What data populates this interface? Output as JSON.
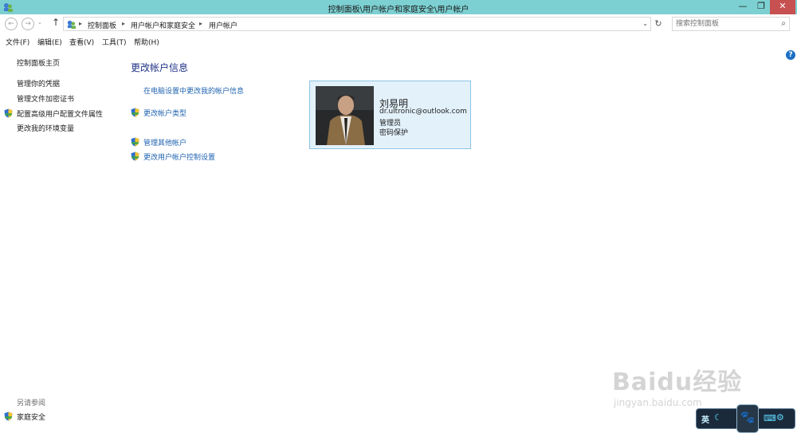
{
  "window": {
    "title": "控制面板\\用户帐户和家庭安全\\用户帐户",
    "minimize_glyph": "—",
    "maximize_glyph": "❐",
    "close_glyph": "✕"
  },
  "address": {
    "crumbs": [
      "控制面板",
      "用户帐户和家庭安全",
      "用户帐户"
    ],
    "separator": "▸",
    "search_placeholder": "搜索控制面板"
  },
  "menu": [
    "文件(F)",
    "编辑(E)",
    "查看(V)",
    "工具(T)",
    "帮助(H)"
  ],
  "sidebar": {
    "home": "控制面板主页",
    "links": [
      "管理你的凭据",
      "管理文件加密证书",
      "配置高级用户配置文件属性",
      "更改我的环境变量"
    ],
    "see_also_title": "另请参阅",
    "see_also_links": [
      "家庭安全"
    ]
  },
  "main": {
    "heading": "更改帐户信息",
    "tasks": [
      "在电脑设置中更改我的帐户信息",
      "更改帐户类型",
      "管理其他帐户",
      "更改用户帐户控制设置"
    ]
  },
  "account": {
    "name": "刘易明",
    "email": "dr.ultronic@outlook.com",
    "role": "管理员",
    "protection": "密码保护"
  },
  "watermark": {
    "main": "Baidu经验",
    "sub": "jingyan.baidu.com"
  },
  "ime": {
    "language": "英",
    "moon": "☾",
    "paw": "🐾",
    "keyboard": "⌨",
    "settings": "⚙"
  },
  "icons": {
    "back": "←",
    "forward": "→",
    "up": "↑",
    "refresh": "↻",
    "search": "⌕",
    "dropdown": "⌄",
    "help": "?"
  },
  "colors": {
    "titlebar": "#7cd0d2",
    "link": "#1f63b0",
    "heading": "#1e3287",
    "card_bg": "#e3f1fb",
    "card_border": "#8cc4e4",
    "close": "#c75050"
  }
}
